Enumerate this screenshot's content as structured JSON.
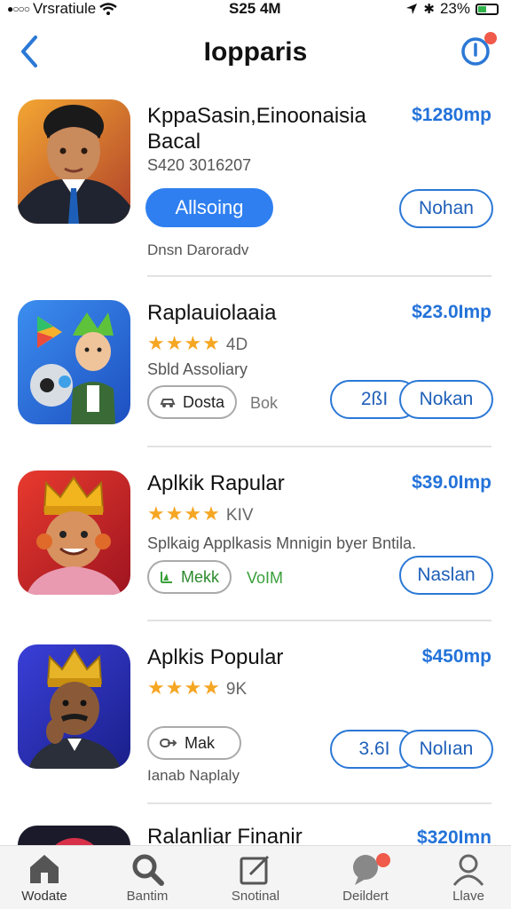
{
  "status_bar": {
    "carrier": "Vrsratiule",
    "time": "S25 4M",
    "battery": "23%"
  },
  "nav": {
    "title": "Iopparis"
  },
  "apps": [
    {
      "name_line1": "KppaSasin,Einoonaisia",
      "name_line2": "Bacal",
      "price": "$1280mp",
      "sub": "S420 3016207",
      "primary_action": "Allsoing",
      "secondary_action": "Nohan",
      "meta": "Dnsn Daroradv"
    },
    {
      "name_line1": "Raplauiolaaia",
      "price": "$23.0Imp",
      "stars": "★★★★",
      "rating": "4D",
      "sub": "Sbld Assoliary",
      "tag_label": "Dosta",
      "tag_extra": "Bok",
      "pill_left": "2ßI",
      "secondary_action": "Nokan"
    },
    {
      "name_line1": "Aplkik Rapular",
      "price": "$39.0Imp",
      "stars": "★★★★",
      "rating": "KIV",
      "sub": "Splkaig Applkasis Mnnigin byer Bntila.",
      "tag_label": "Mekk",
      "tag_extra": "VoIM",
      "secondary_action": "Naslan"
    },
    {
      "name_line1": "Aplkis Popular",
      "price": "$450mp",
      "stars": "★★★★",
      "rating": "9K",
      "tag_label": "Mak",
      "pill_left": "3.6I",
      "secondary_action": "Nolıan",
      "meta": "Ianab Naplaly"
    },
    {
      "name_line1": "Ralanliar Finanir",
      "price": "$320Imn"
    }
  ],
  "tabs": [
    {
      "label": "Wodate",
      "icon": "home-icon"
    },
    {
      "label": "Bantim",
      "icon": "search-icon"
    },
    {
      "label": "Snotinal",
      "icon": "edit-icon"
    },
    {
      "label": "Deildert",
      "icon": "chat-icon"
    },
    {
      "label": "Llave",
      "icon": "profile-icon"
    }
  ],
  "colors": {
    "accent": "#2f7ff0",
    "price": "#2372d9",
    "star": "#f5a623",
    "badge": "#ef5a4a"
  }
}
